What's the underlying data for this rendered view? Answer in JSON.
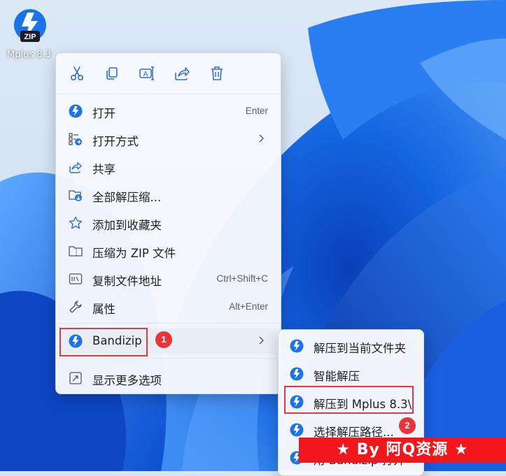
{
  "desktop": {
    "icon": "zip-archive-icon",
    "icon_badge_text": "ZIP",
    "label": "Mplus 8.3"
  },
  "toolbar": {
    "icons": [
      "scissors-icon",
      "copy-icon",
      "rename-icon",
      "share-icon",
      "trash-icon"
    ]
  },
  "menu": {
    "items": [
      {
        "label": "打开",
        "shortcut": "Enter",
        "icon": "bandizip-icon"
      },
      {
        "label": "打开方式",
        "shortcut": "",
        "icon": "open-with-icon",
        "submenu": true
      },
      {
        "label": "共享",
        "shortcut": "",
        "icon": "share-icon"
      },
      {
        "label": "全部解压缩...",
        "shortcut": "",
        "icon": "extract-all-icon"
      },
      {
        "label": "添加到收藏夹",
        "shortcut": "",
        "icon": "star-icon"
      },
      {
        "label": "压缩为 ZIP 文件",
        "shortcut": "",
        "icon": "zip-folder-icon"
      },
      {
        "label": "复制文件地址",
        "shortcut": "Ctrl+Shift+C",
        "icon": "copy-path-icon"
      },
      {
        "label": "属性",
        "shortcut": "Alt+Enter",
        "icon": "wrench-icon"
      },
      {
        "label": "Bandizip",
        "shortcut": "",
        "icon": "bandizip-icon",
        "submenu": true
      },
      {
        "label": "显示更多选项",
        "shortcut": "",
        "icon": "more-options-icon"
      }
    ]
  },
  "submenu": {
    "items": [
      {
        "label": "解压到当前文件夹",
        "icon": "bandizip-icon"
      },
      {
        "label": "智能解压",
        "icon": "bandizip-icon"
      },
      {
        "label": "解压到 Mplus 8.3\\",
        "icon": "bandizip-icon"
      },
      {
        "label": "选择解压路径...",
        "icon": "bandizip-icon"
      },
      {
        "label": "用 Bandizip 打开",
        "icon": "bandizip-icon"
      }
    ]
  },
  "annotations": {
    "step1": "1",
    "step2": "2",
    "color": "#e0393e"
  },
  "watermark": "★ By 阿Q资源 ★",
  "colors": {
    "accent_blue": "#1a73e8",
    "annotation_red": "#e0393e",
    "banner_red": "#f2171d"
  }
}
